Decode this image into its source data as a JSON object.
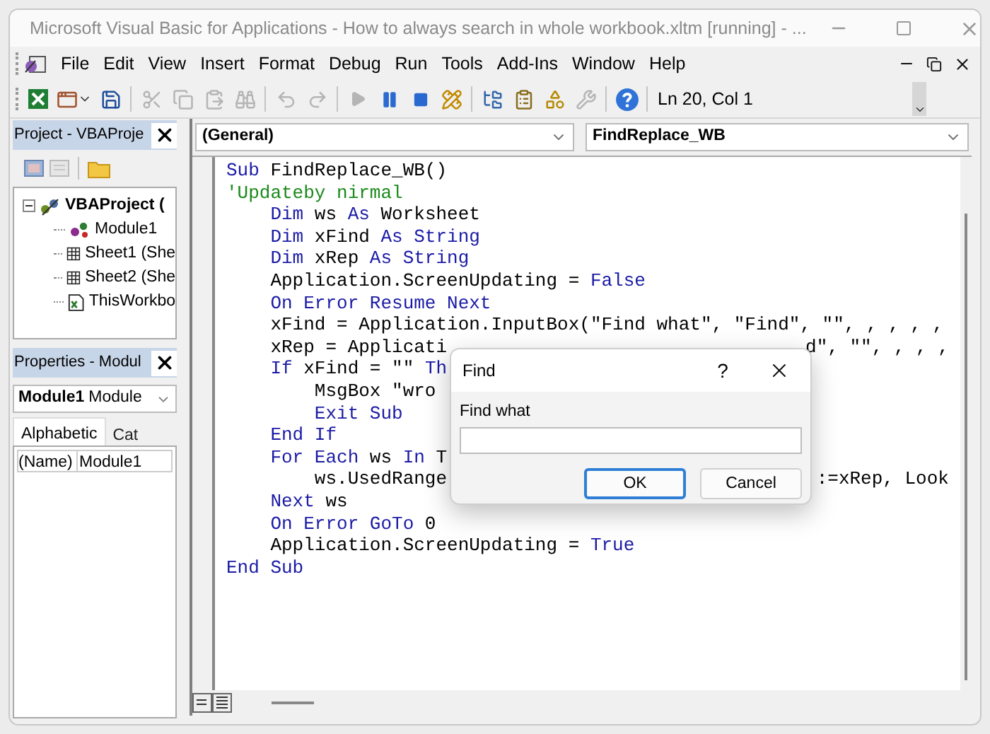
{
  "window": {
    "title": "Microsoft Visual Basic for Applications - How to always search in whole workbook.xltm [running] - ..."
  },
  "menu": [
    "File",
    "Edit",
    "View",
    "Insert",
    "Format",
    "Debug",
    "Run",
    "Tools",
    "Add-Ins",
    "Window",
    "Help"
  ],
  "toolbar": {
    "groups": [
      [
        {
          "kind": "excel",
          "disabled": false
        },
        {
          "kind": "userform",
          "disabled": false
        },
        {
          "kind": "save",
          "disabled": false
        }
      ],
      [
        {
          "kind": "cut",
          "disabled": true
        },
        {
          "kind": "copy",
          "disabled": true
        },
        {
          "kind": "paste",
          "disabled": true
        },
        {
          "kind": "find",
          "disabled": true
        }
      ],
      [
        {
          "kind": "undo",
          "disabled": true
        },
        {
          "kind": "redo",
          "disabled": true
        }
      ],
      [
        {
          "kind": "run",
          "disabled": true
        },
        {
          "kind": "pause",
          "disabled": false
        },
        {
          "kind": "stop",
          "disabled": false
        },
        {
          "kind": "design",
          "disabled": false
        }
      ],
      [
        {
          "kind": "project",
          "disabled": false
        },
        {
          "kind": "properties",
          "disabled": false
        },
        {
          "kind": "browser",
          "disabled": false
        },
        {
          "kind": "toolbox",
          "disabled": true
        }
      ],
      [
        {
          "kind": "help",
          "disabled": false
        }
      ]
    ],
    "position": "Ln 20, Col 1"
  },
  "project_panel": {
    "title": "Project - VBAProje",
    "tree": [
      {
        "label": "VBAProject (",
        "kind": "project",
        "expanded": true,
        "children": [
          {
            "label": "Module1",
            "kind": "module"
          },
          {
            "label": "Sheet1 (She",
            "kind": "sheet"
          },
          {
            "label": "Sheet2 (She",
            "kind": "sheet"
          },
          {
            "label": "ThisWorkbo",
            "kind": "workbook"
          }
        ]
      }
    ]
  },
  "properties_panel": {
    "title": "Properties - Modul",
    "object": {
      "name": "Module1",
      "type": "Module"
    },
    "tabs": [
      {
        "label": "Alphabetic",
        "selected": true
      },
      {
        "label": "Cat",
        "selected": false
      }
    ],
    "rows": [
      {
        "name": "(Name)",
        "value": "Module1"
      }
    ]
  },
  "code_window": {
    "object": "(General)",
    "procedure": "FindReplace_WB",
    "lines": [
      {
        "parts": [
          {
            "kind": "keyword",
            "text": "Sub"
          },
          {
            "kind": "plain",
            "text": " FindReplace_WB()"
          }
        ]
      },
      {
        "parts": [
          {
            "kind": "comment",
            "text": "'Updateby nirmal"
          }
        ]
      },
      {
        "parts": [
          {
            "kind": "keyword",
            "text": "    Dim"
          },
          {
            "kind": "plain",
            "text": " ws "
          },
          {
            "kind": "keyword",
            "text": "As"
          },
          {
            "kind": "plain",
            "text": " Worksheet"
          }
        ]
      },
      {
        "parts": [
          {
            "kind": "keyword",
            "text": "    Dim"
          },
          {
            "kind": "plain",
            "text": " xFind "
          },
          {
            "kind": "keyword",
            "text": "As String"
          }
        ]
      },
      {
        "parts": [
          {
            "kind": "keyword",
            "text": "    Dim"
          },
          {
            "kind": "plain",
            "text": " xRep "
          },
          {
            "kind": "keyword",
            "text": "As String"
          }
        ]
      },
      {
        "parts": [
          {
            "kind": "plain",
            "text": "    Application.ScreenUpdating = "
          },
          {
            "kind": "keyword",
            "text": "False"
          }
        ]
      },
      {
        "parts": [
          {
            "kind": "keyword",
            "text": "    On Error Resume Next"
          }
        ]
      },
      {
        "parts": [
          {
            "kind": "plain",
            "text": "    xFind = Application.InputBox(\"Find what\", \"Find\", \"\", , , , ,"
          }
        ]
      },
      {
        "parts": [
          {
            "kind": "plain",
            "text": "    xRep = Applicati"
          }
        ],
        "right": [
          {
            "kind": "plain",
            "text": "d\", \"\", , , ,"
          }
        ]
      },
      {
        "parts": [
          {
            "kind": "keyword",
            "text": "    If"
          },
          {
            "kind": "plain",
            "text": " xFind = \"\" "
          },
          {
            "kind": "keyword",
            "text": "Th"
          }
        ]
      },
      {
        "parts": [
          {
            "kind": "plain",
            "text": "        MsgBox \"wro"
          }
        ]
      },
      {
        "parts": [
          {
            "kind": "keyword",
            "text": "        Exit Sub"
          }
        ]
      },
      {
        "parts": [
          {
            "kind": "keyword",
            "text": "    End If"
          }
        ]
      },
      {
        "parts": [
          {
            "kind": "keyword",
            "text": "    For Each"
          },
          {
            "kind": "plain",
            "text": " ws "
          },
          {
            "kind": "keyword",
            "text": "In"
          },
          {
            "kind": "plain",
            "text": " T"
          }
        ]
      },
      {
        "parts": [
          {
            "kind": "plain",
            "text": "        ws.UsedRange"
          }
        ],
        "right": [
          {
            "kind": "plain",
            "text": ":=xRep, Look"
          }
        ]
      },
      {
        "parts": [
          {
            "kind": "keyword",
            "text": "    Next"
          },
          {
            "kind": "plain",
            "text": " ws"
          }
        ]
      },
      {
        "parts": [
          {
            "kind": "keyword",
            "text": "    On Error GoTo"
          },
          {
            "kind": "plain",
            "text": " 0"
          }
        ]
      },
      {
        "parts": [
          {
            "kind": "plain",
            "text": "    Application.ScreenUpdating = "
          },
          {
            "kind": "keyword",
            "text": "True"
          }
        ]
      },
      {
        "parts": [
          {
            "kind": "keyword",
            "text": "End Sub"
          }
        ]
      }
    ]
  },
  "dialog": {
    "title": "Find",
    "help": "?",
    "label": "Find what",
    "buttons": [
      {
        "label": "OK",
        "selected": true
      },
      {
        "label": "Cancel",
        "selected": false
      }
    ]
  }
}
